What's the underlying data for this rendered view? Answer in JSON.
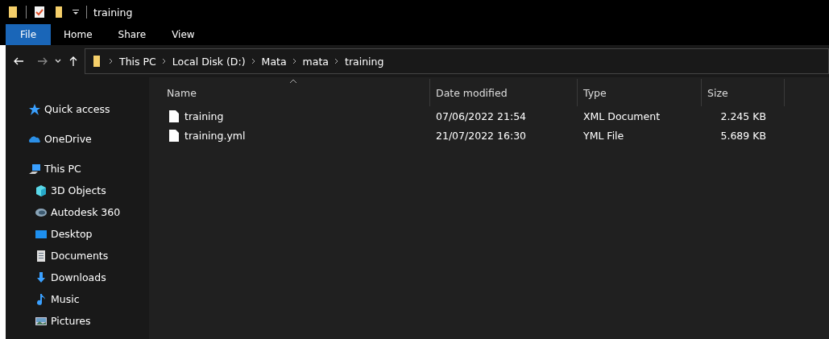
{
  "window": {
    "title": "training"
  },
  "ribbon_tabs": [
    {
      "label": "File",
      "selected": true
    },
    {
      "label": "Home",
      "selected": false
    },
    {
      "label": "Share",
      "selected": false
    },
    {
      "label": "View",
      "selected": false
    }
  ],
  "address_bar": {
    "path": [
      "This PC",
      "Local Disk (D:)",
      "Mata",
      "mata",
      "training"
    ]
  },
  "sidebar": {
    "items": [
      {
        "label": "Quick access",
        "kind": "star"
      },
      {
        "label": "OneDrive",
        "kind": "cloud"
      },
      {
        "label": "This PC",
        "kind": "pc",
        "children": [
          {
            "label": "3D Objects",
            "kind": "cube"
          },
          {
            "label": "Autodesk 360",
            "kind": "autodesk"
          },
          {
            "label": "Desktop",
            "kind": "desktop"
          },
          {
            "label": "Documents",
            "kind": "documents"
          },
          {
            "label": "Downloads",
            "kind": "downloads"
          },
          {
            "label": "Music",
            "kind": "music"
          },
          {
            "label": "Pictures",
            "kind": "pictures"
          }
        ]
      }
    ]
  },
  "table": {
    "columns": [
      {
        "label": "Name",
        "sorted": true
      },
      {
        "label": "Date modified",
        "sorted": false
      },
      {
        "label": "Type",
        "sorted": false
      },
      {
        "label": "Size",
        "sorted": false
      }
    ],
    "rows": [
      {
        "name": "training",
        "date": "07/06/2022 21:54",
        "type": "XML Document",
        "size": "2.245 KB"
      },
      {
        "name": "training.yml",
        "date": "21/07/2022 16:30",
        "type": "YML File",
        "size": "5.689 KB"
      }
    ]
  }
}
